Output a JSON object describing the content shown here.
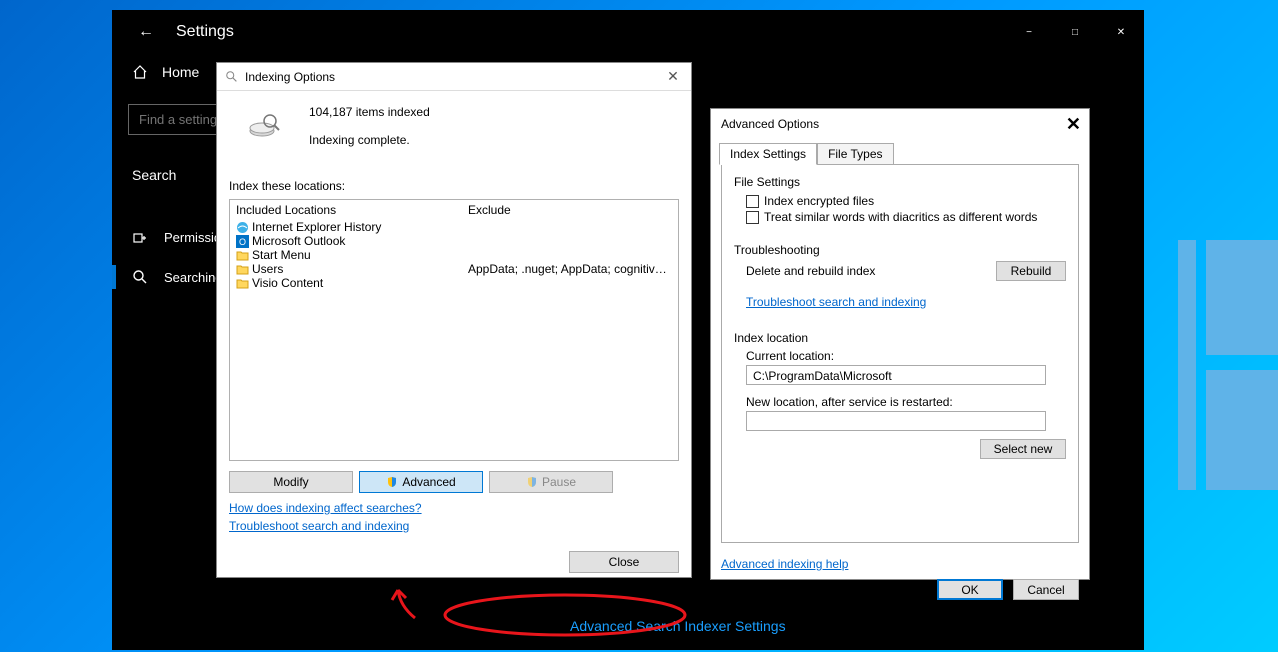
{
  "settings": {
    "title": "Settings",
    "home": "Home",
    "search_placeholder": "Find a setting",
    "category": "Search",
    "nav": {
      "permissions": "Permissions & History",
      "searching": "Searching Windows"
    },
    "link": "Advanced Search Indexer Settings"
  },
  "indexing": {
    "title": "Indexing Options",
    "items_indexed": "104,187 items indexed",
    "status": "Indexing complete.",
    "locations_label": "Index these locations:",
    "col_included": "Included Locations",
    "col_exclude": "Exclude",
    "rows": [
      {
        "name": "Internet Explorer History",
        "exclude": ""
      },
      {
        "name": "Microsoft Outlook",
        "exclude": ""
      },
      {
        "name": "Start Menu",
        "exclude": ""
      },
      {
        "name": "Users",
        "exclude": "AppData; .nuget; AppData; cognitive-services..."
      },
      {
        "name": "Visio Content",
        "exclude": ""
      }
    ],
    "btn_modify": "Modify",
    "btn_advanced": "Advanced",
    "btn_pause": "Pause",
    "link_how": "How does indexing affect searches?",
    "link_trouble": "Troubleshoot search and indexing",
    "btn_close": "Close"
  },
  "advanced": {
    "title": "Advanced Options",
    "tab_index": "Index Settings",
    "tab_file": "File Types",
    "file_settings": "File Settings",
    "chk_encrypted": "Index encrypted files",
    "chk_diacritics": "Treat similar words with diacritics as different words",
    "troubleshooting": "Troubleshooting",
    "delete_rebuild": "Delete and rebuild index",
    "btn_rebuild": "Rebuild",
    "link_trouble": "Troubleshoot search and indexing",
    "index_location": "Index location",
    "current_location": "Current location:",
    "current_path": "C:\\ProgramData\\Microsoft",
    "new_location": "New location, after service is restarted:",
    "btn_select_new": "Select new",
    "link_help": "Advanced indexing help",
    "btn_ok": "OK",
    "btn_cancel": "Cancel"
  }
}
